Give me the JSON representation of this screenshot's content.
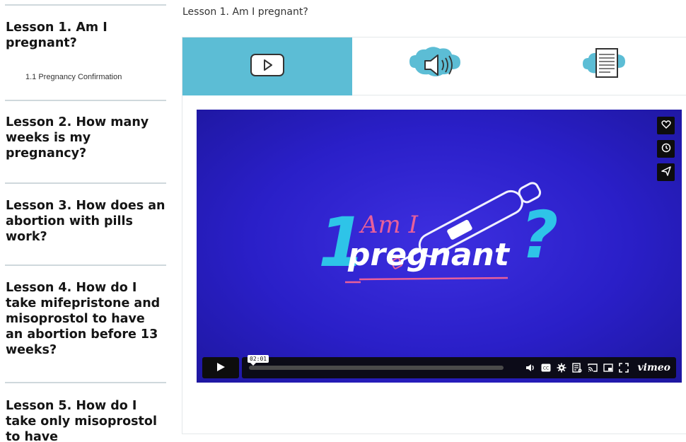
{
  "sidebar": {
    "lessons": [
      {
        "title": "Lesson 1. Am I pregnant?",
        "sub": "1.1 Pregnancy Confirmation"
      },
      {
        "title": "Lesson 2. How many weeks is my pregnancy?"
      },
      {
        "title": "Lesson 3. How does an abortion with pills work?"
      },
      {
        "title": "Lesson 4. How do I take mifepristone and misoprostol to have an abortion before 13 weeks?"
      },
      {
        "title": "Lesson 5. How do I take only misoprostol to have"
      }
    ]
  },
  "main": {
    "title": "Lesson 1. Am I pregnant?",
    "tabs": [
      {
        "name": "video",
        "icon": "play-icon",
        "active": true
      },
      {
        "name": "audio",
        "icon": "speaker-icon",
        "active": false
      },
      {
        "name": "text",
        "icon": "document-icon",
        "active": false
      }
    ]
  },
  "video": {
    "title_number": "1",
    "title_line1": "Am I",
    "title_line2": "pregnant",
    "title_mark": "?",
    "time": "02:01",
    "brand": "vimeo"
  },
  "colors": {
    "tab_active": "#5cbdd5",
    "video_bg": "#2a1fc8",
    "accent_cyan": "#2ec4e8",
    "accent_pink": "#e8609a"
  }
}
